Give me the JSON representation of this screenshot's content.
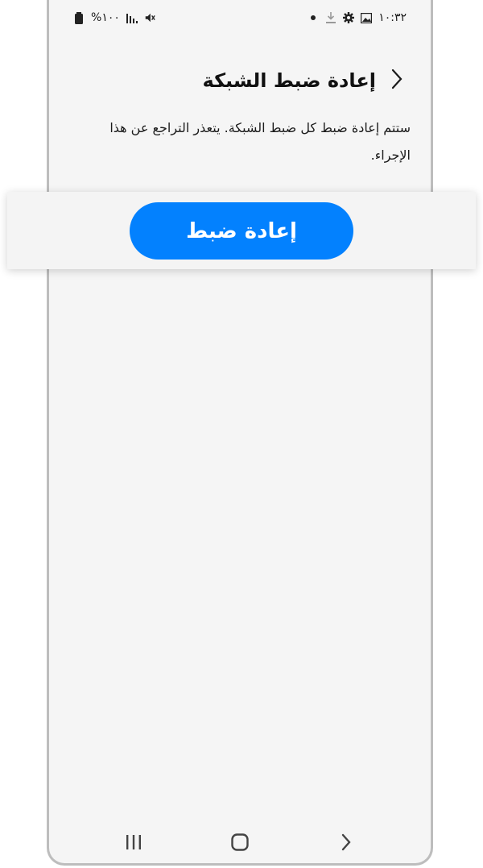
{
  "status_bar": {
    "battery_text": "%١٠٠",
    "time": "١٠:٣٢",
    "left_icons": [
      "battery-icon",
      "signal-icon",
      "mute-icon"
    ],
    "right_icons": [
      "dot-icon",
      "download-icon",
      "gear-icon",
      "image-icon"
    ]
  },
  "header": {
    "title": "إعادة ضبط الشبكة",
    "back_icon": "chevron-right-icon"
  },
  "description": "ستتم إعادة ضبط كل ضبط الشبكة. يتعذر التراجع عن هذا الإجراء.",
  "reset_button": {
    "label": "إعادة ضبط",
    "color": "#0381fe"
  },
  "nav_bar": {
    "items": [
      "recents-icon",
      "home-icon",
      "back-icon"
    ]
  },
  "colors": {
    "background": "#f5f5f5",
    "accent": "#0381fe",
    "frame": "#bdbdbd"
  }
}
